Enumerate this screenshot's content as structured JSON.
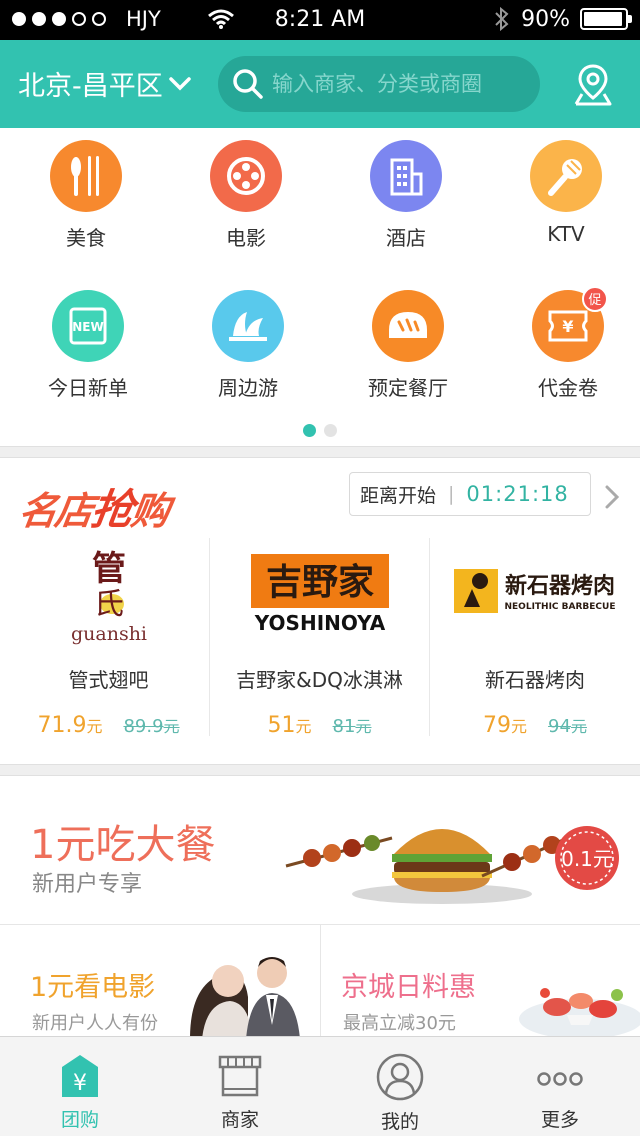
{
  "status_bar": {
    "carrier": "HJY",
    "time": "8:21 AM",
    "battery": "90%"
  },
  "header": {
    "city": "北京-昌平区",
    "search_placeholder": "输入商家、分类或商圈"
  },
  "categories": [
    {
      "label": "美食",
      "color": "#f7892e",
      "icon": "fork-knife-icon"
    },
    {
      "label": "电影",
      "color": "#f26a4a",
      "icon": "film-reel-icon"
    },
    {
      "label": "酒店",
      "color": "#7c86f0",
      "icon": "building-icon"
    },
    {
      "label": "KTV",
      "color": "#fbb44a",
      "icon": "microphone-icon"
    },
    {
      "label": "今日新单",
      "color": "#3fd4b7",
      "icon": "new-badge-icon"
    },
    {
      "label": "周边游",
      "color": "#59c9ec",
      "icon": "sydney-opera-icon"
    },
    {
      "label": "预定餐厅",
      "color": "#f78a27",
      "icon": "bread-icon"
    },
    {
      "label": "代金卷",
      "color": "#f7892e",
      "icon": "voucher-icon",
      "badge": "促"
    }
  ],
  "flash_sale": {
    "title_a": "名店",
    "title_b": "抢",
    "title_c": "购",
    "countdown_label": "距离开始",
    "countdown_time": "01:21:18",
    "shops": [
      {
        "name": "管式翅吧",
        "price": "71.9",
        "old_price": "89.9",
        "unit": "元",
        "logo_text": "管氏",
        "logo_sub": "guanshi"
      },
      {
        "name": "吉野家&DQ冰淇淋",
        "price": "51",
        "old_price": "81",
        "unit": "元",
        "logo_text": "吉野家",
        "logo_sub": "YOSHINOYA"
      },
      {
        "name": "新石器烤肉",
        "price": "79",
        "old_price": "94",
        "unit": "元",
        "logo_text": "新石器烤肉",
        "logo_sub": "NEOLITHIC BARBECUE"
      }
    ]
  },
  "banner": {
    "title": "1元吃大餐",
    "subtitle": "新用户专享",
    "tag": "0.1元"
  },
  "promos": [
    {
      "title": "1元看电影",
      "subtitle": "新用户人人有份"
    },
    {
      "title": "京城日料惠",
      "subtitle": "最高立减30元"
    }
  ],
  "tabbar": [
    {
      "label": "团购",
      "icon": "group-buy-icon",
      "active": true
    },
    {
      "label": "商家",
      "icon": "store-icon",
      "active": false
    },
    {
      "label": "我的",
      "icon": "user-icon",
      "active": false
    },
    {
      "label": "更多",
      "icon": "more-dots-icon",
      "active": false
    }
  ],
  "colors": {
    "accent": "#32c2b0",
    "price": "#f0a32d",
    "sale_red": "#ef5a3a"
  }
}
